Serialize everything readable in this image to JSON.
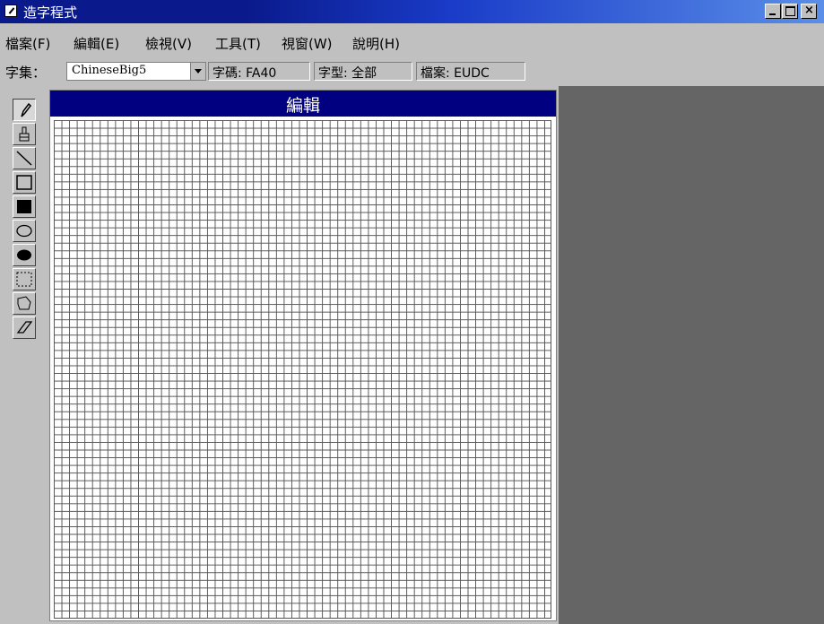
{
  "window": {
    "title": "造字程式"
  },
  "menu": {
    "items": [
      "檔案(F)",
      "編輯(E)",
      "檢視(V)",
      "工具(T)",
      "視窗(W)",
      "說明(H)"
    ]
  },
  "toolbar": {
    "charset_label": "字集：",
    "charset_value": "ChineseBig5",
    "char_code": "字碼: FA40",
    "font_type": "字型: 全部",
    "file": "檔案: EUDC"
  },
  "edit_window": {
    "title": "編輯"
  },
  "tools": [
    "pencil-icon",
    "brush-icon",
    "line-icon",
    "hollow-rectangle-icon",
    "filled-rectangle-icon",
    "hollow-ellipse-icon",
    "filled-ellipse-icon",
    "rectangular-select-icon",
    "freeform-select-icon",
    "eraser-icon"
  ]
}
